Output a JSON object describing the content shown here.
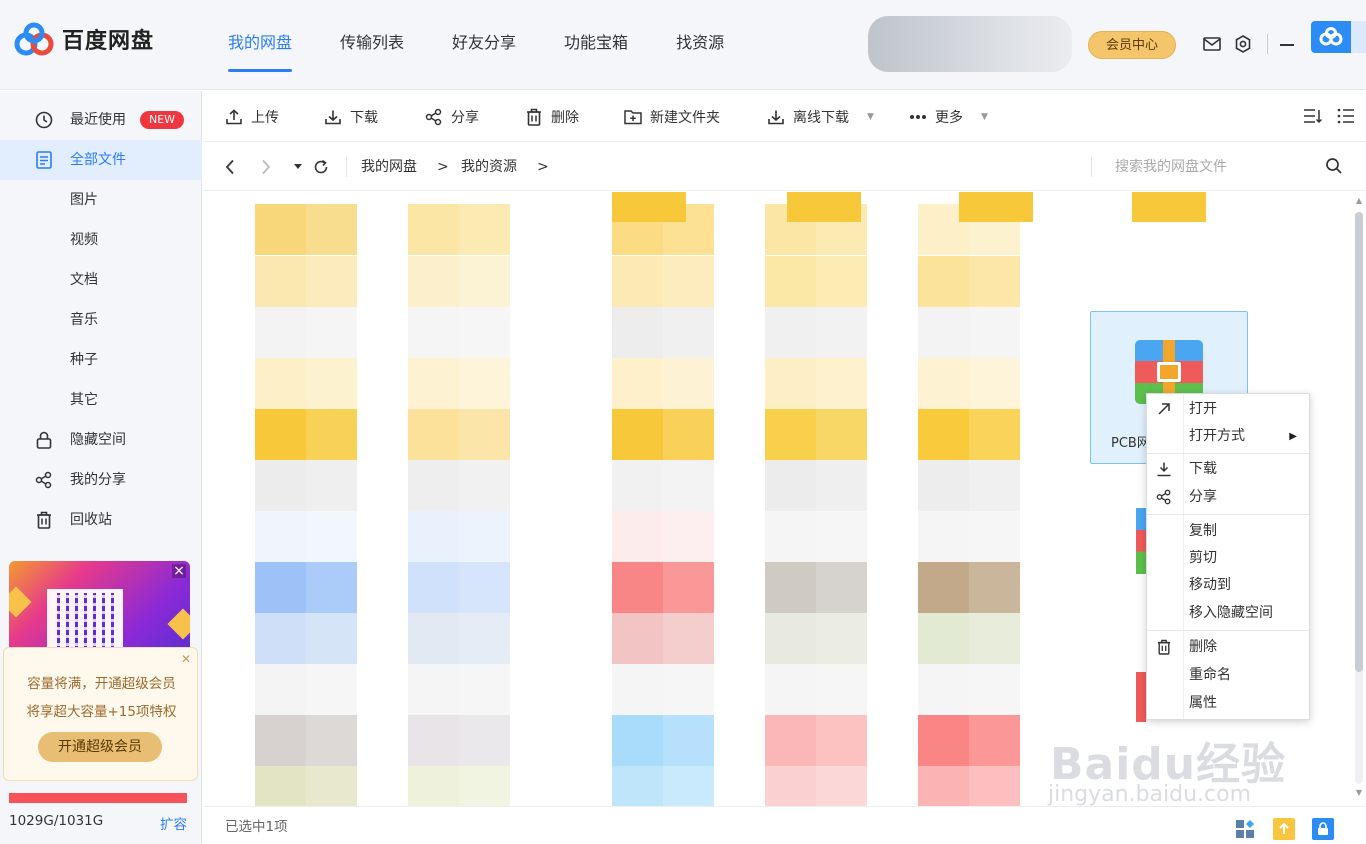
{
  "app": {
    "name": "百度网盘",
    "brand_color": "#2c7cf6"
  },
  "nav": {
    "items": [
      {
        "label": "我的网盘",
        "active": true
      },
      {
        "label": "传输列表"
      },
      {
        "label": "好友分享"
      },
      {
        "label": "功能宝箱"
      },
      {
        "label": "找资源"
      }
    ]
  },
  "header": {
    "vip_label": "会员中心"
  },
  "sidebar": {
    "items": [
      {
        "label": "最近使用",
        "badge": "NEW",
        "icon": "clock-icon"
      },
      {
        "label": "全部文件",
        "active": true,
        "icon": "file-icon"
      },
      {
        "label": "图片"
      },
      {
        "label": "视频"
      },
      {
        "label": "文档"
      },
      {
        "label": "音乐"
      },
      {
        "label": "种子"
      },
      {
        "label": "其它"
      },
      {
        "label": "隐藏空间",
        "icon": "lock-icon"
      },
      {
        "label": "我的分享",
        "icon": "share-icon"
      },
      {
        "label": "回收站",
        "icon": "trash-icon"
      }
    ],
    "capacity_card": {
      "line1": "容量将满，开通超级会员",
      "line2": "将享超大容量+15项特权",
      "button": "开通超级会员"
    },
    "usage": {
      "text": "1029G/1031G",
      "fraction": 0.998,
      "expand_label": "扩容"
    }
  },
  "toolbar": {
    "upload": "上传",
    "download": "下载",
    "share": "分享",
    "delete": "删除",
    "new_folder": "新建文件夹",
    "offline_download": "离线下载",
    "more": "更多"
  },
  "path": {
    "crumbs": [
      "我的网盘",
      "我的资源"
    ],
    "separator": ">",
    "search_placeholder": "搜索我的网盘文件"
  },
  "selected_file": {
    "name": "PCB网"
  },
  "context_menu": {
    "items": [
      {
        "label": "打开",
        "icon": "open-arrow-icon"
      },
      {
        "label": "打开方式",
        "submenu": true
      },
      {
        "label": "下载",
        "icon": "download-icon"
      },
      {
        "label": "分享",
        "icon": "share-icon"
      },
      {
        "label": "复制"
      },
      {
        "label": "剪切"
      },
      {
        "label": "移动到"
      },
      {
        "label": "移入隐藏空间"
      },
      {
        "label": "删除",
        "icon": "trash-icon"
      },
      {
        "label": "重命名"
      },
      {
        "label": "属性"
      }
    ]
  },
  "status": {
    "selection_text": "已选中1项"
  },
  "watermark": {
    "main": "Baidu经验",
    "sub": "jingyan.baidu.com"
  }
}
